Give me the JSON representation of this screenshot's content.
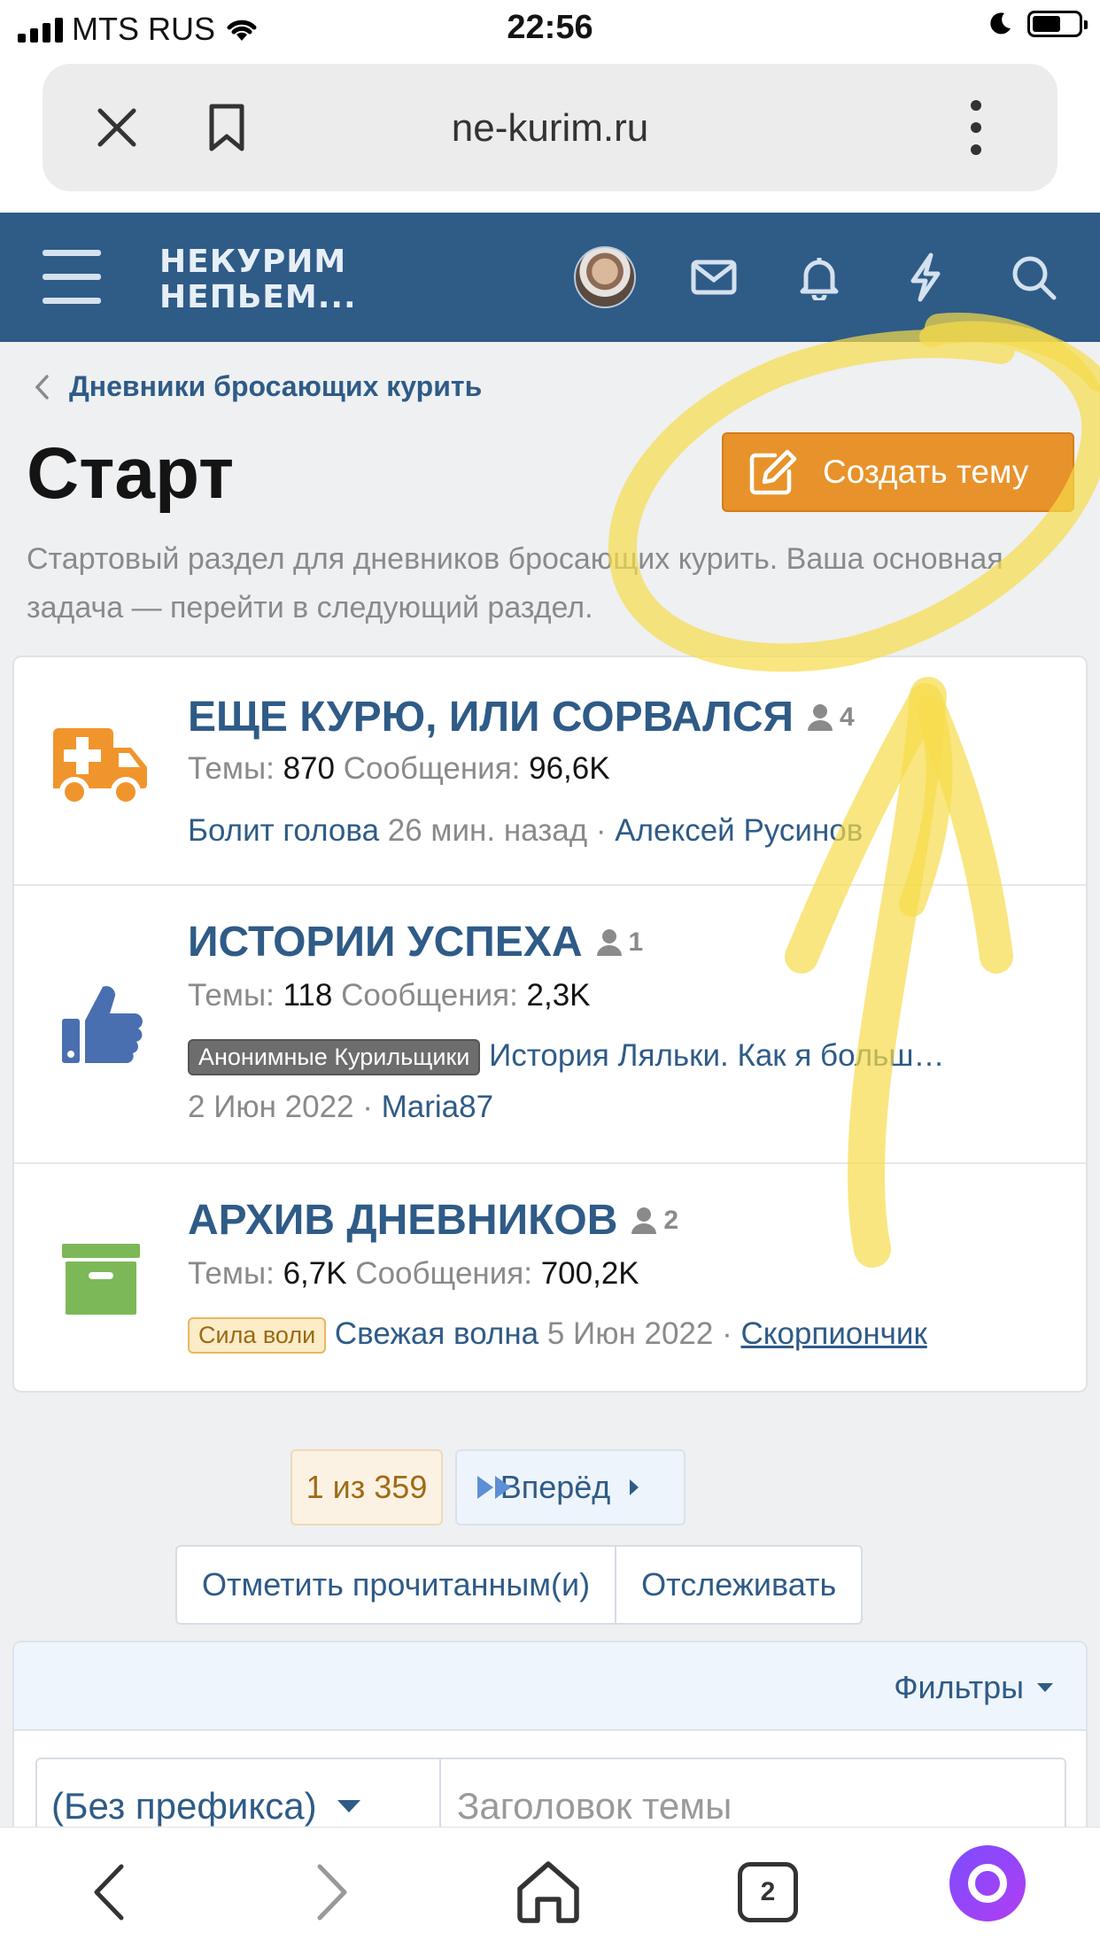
{
  "status": {
    "carrier": "MTS RUS",
    "time": "22:56"
  },
  "browser": {
    "url": "ne-kurim.ru",
    "tabs_count": "2"
  },
  "site": {
    "logo_line1": "НЕКУРИМ",
    "logo_line2": "НЕПЬЕМ..."
  },
  "breadcrumb": "Дневники бросающих курить",
  "page": {
    "title": "Старт",
    "create_button": "Создать тему",
    "description": "Стартовый раздел для дневников бросающих курить. Ваша основная задача — перейти в следующий раздел."
  },
  "labels": {
    "threads": "Темы:",
    "messages": "Сообщения:"
  },
  "nodes": [
    {
      "title": "ЕЩЕ КУРЮ, ИЛИ СОРВАЛСЯ",
      "users": "4",
      "threads": "870",
      "messages": "96,6K",
      "last_thread": "Болит голова",
      "last_time": "26 мин. назад",
      "last_user": "Алексей Русинов",
      "icon": "ambulance-icon",
      "color": "#f0952c"
    },
    {
      "title": "ИСТОРИИ УСПЕХА",
      "users": "1",
      "threads": "118",
      "messages": "2,3K",
      "prefix": "Анонимные Курильщики",
      "last_thread": "История Ляльки. Как я больш…",
      "last_time": "2 Июн 2022",
      "last_user": "Maria87",
      "icon": "thumbs-up-icon",
      "color": "#4a6fb0"
    },
    {
      "title": "АРХИВ ДНЕВНИКОВ",
      "users": "2",
      "threads": "6,7K",
      "messages": "700,2K",
      "prefix": "Сила воли",
      "last_thread": "Свежая волна",
      "last_time": "5 Июн 2022",
      "last_user": "Скорпиончик",
      "icon": "archive-box-icon",
      "color": "#7cb857"
    }
  ],
  "pagination": {
    "current": "1 из 359",
    "next": "Вперёд"
  },
  "actions": {
    "mark_read": "Отметить прочитанным(и)",
    "watch": "Отслеживать"
  },
  "filters": {
    "label": "Фильтры",
    "prefix_select": "(Без префикса)",
    "title_placeholder": "Заголовок темы"
  },
  "colors": {
    "header": "#2f5b87",
    "accent": "#e8922b",
    "link": "#2f5b87",
    "marker": "#f7dc4a"
  }
}
